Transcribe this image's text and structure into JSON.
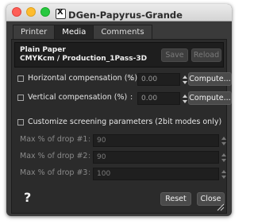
{
  "window": {
    "title": "DGen-Papyrus-Grande"
  },
  "tabs": [
    {
      "label": "Printer"
    },
    {
      "label": "Media"
    },
    {
      "label": "Comments"
    }
  ],
  "media": {
    "paper": "Plain Paper",
    "mode": "CMYKcm / Production_1Pass-3D",
    "save_label": "Save",
    "reload_label": "Reload"
  },
  "horizontal": {
    "label": "Horizontal compensation (%)",
    "colon": ":",
    "value": "0.00",
    "compute_label": "Compute..."
  },
  "vertical": {
    "label": "Vertical compensation (%)",
    "colon": ":",
    "value": "0.00",
    "compute_label": "Compute..."
  },
  "screening": {
    "label": "Customize screening parameters (2bit modes only)"
  },
  "drops": [
    {
      "label": "Max % of drop #1",
      "colon": ":",
      "value": "90"
    },
    {
      "label": "Max % of drop #2",
      "colon": ":",
      "value": "90"
    },
    {
      "label": "Max % of drop #3",
      "colon": ":",
      "value": "100"
    }
  ],
  "footer": {
    "help_label": "?",
    "reset_label": "Reset",
    "close_label": "Close"
  },
  "colors": {
    "window_bg": "#3a3a3a",
    "panel_bg": "#2b2b2b",
    "close_button": "#fe5f57",
    "minimize_button": "#febc2e",
    "maximize_button": "#28c840"
  },
  "icons": {
    "app": "x11-icon",
    "help": "question-mark",
    "resize": "resize-grip-icon"
  }
}
